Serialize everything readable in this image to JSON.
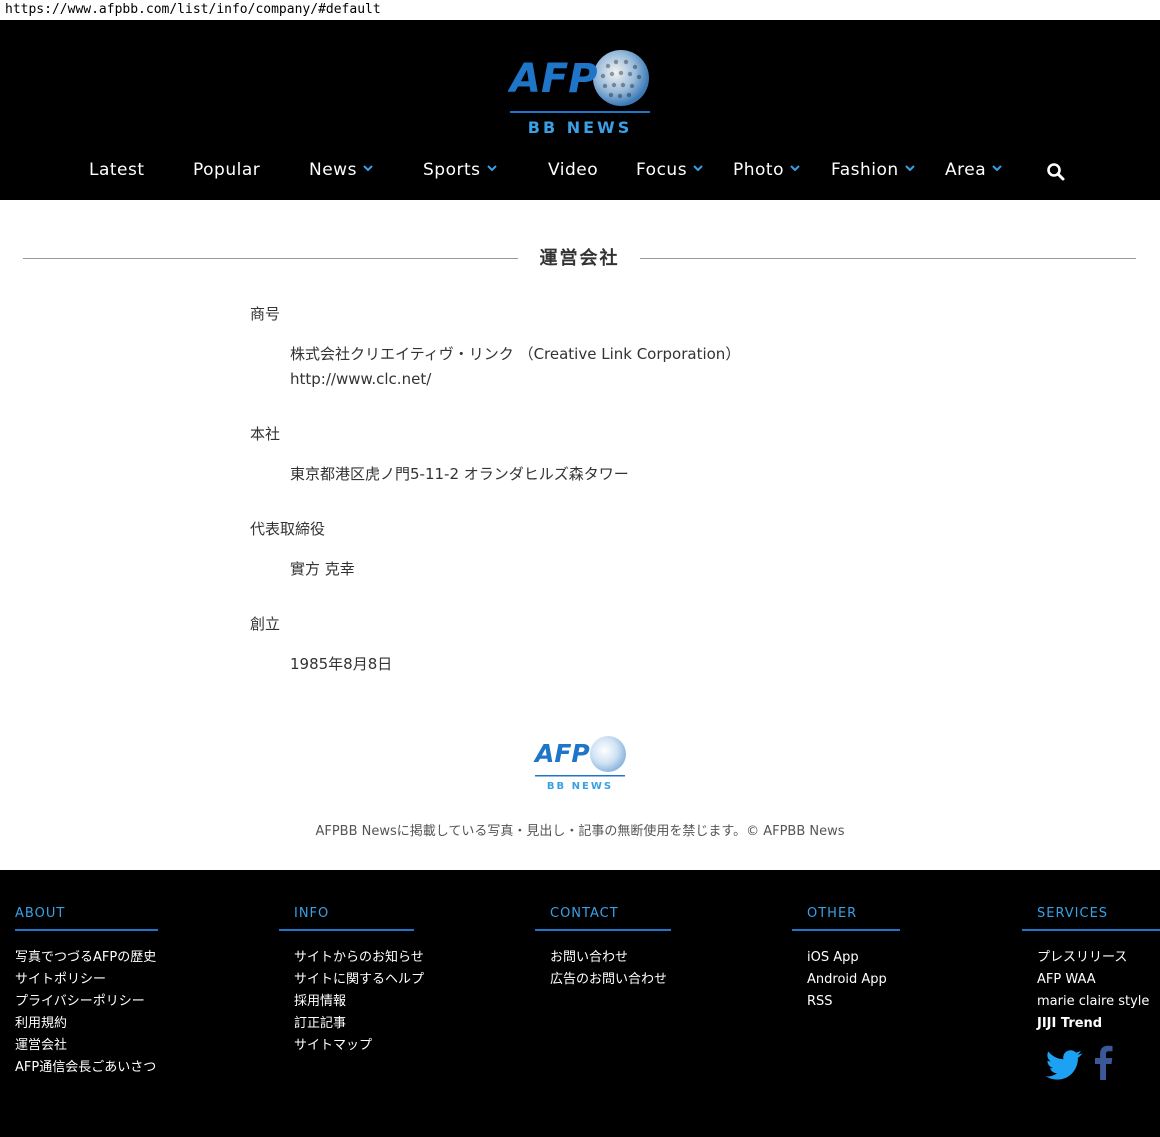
{
  "url": "https://www.afpbb.com/list/info/company/#default",
  "brand": {
    "logo_text": "AFP",
    "logo_sub": "BB NEWS",
    "accent": "#1f75c8",
    "accent_light": "#3aa0e6"
  },
  "nav": {
    "items": [
      {
        "label": "Latest",
        "has_menu": false
      },
      {
        "label": "Popular",
        "has_menu": false
      },
      {
        "label": "News",
        "has_menu": true
      },
      {
        "label": "Sports",
        "has_menu": true
      },
      {
        "label": "Video",
        "has_menu": false
      },
      {
        "label": "Focus",
        "has_menu": true
      },
      {
        "label": "Photo",
        "has_menu": true
      },
      {
        "label": "Fashion",
        "has_menu": true
      },
      {
        "label": "Area",
        "has_menu": true
      }
    ],
    "search_icon": "search-icon"
  },
  "page": {
    "title": "運営会社",
    "sections": [
      {
        "label": "商号",
        "lines": [
          "株式会社クリエイティヴ・リンク （Creative Link Corporation）",
          "http://www.clc.net/"
        ]
      },
      {
        "label": "本社",
        "lines": [
          "東京都港区虎ノ門5-11-2 オランダヒルズ森タワー"
        ]
      },
      {
        "label": "代表取締役",
        "lines": [
          "實方 克幸"
        ]
      },
      {
        "label": "創立",
        "lines": [
          "1985年8月8日"
        ]
      }
    ]
  },
  "copyright": "AFPBB Newsに掲載している写真・見出し・記事の無断使用を禁じます。© AFPBB News",
  "footer": {
    "about": {
      "heading": "ABOUT",
      "links": [
        "写真でつづるAFPの歴史",
        "サイトポリシー",
        "プライバシーポリシー",
        "利用規約",
        "運営会社",
        "AFP通信会長ごあいさつ"
      ]
    },
    "info": {
      "heading": "INFO",
      "links": [
        "サイトからのお知らせ",
        "サイトに関するヘルプ",
        "採用情報",
        "訂正記事",
        "サイトマップ"
      ]
    },
    "contact": {
      "heading": "CONTACT",
      "links": [
        "お問い合わせ",
        "広告のお問い合わせ"
      ]
    },
    "other": {
      "heading": "OTHER",
      "links": [
        "iOS App",
        "Android App",
        "RSS"
      ]
    },
    "services": {
      "heading": "SERVICES",
      "links": [
        "プレスリリース",
        "AFP WAA",
        "marie claire style"
      ],
      "jiji_logo": "JIJI Trend"
    },
    "social": {
      "twitter_color": "#1da1f2",
      "facebook_color": "#3b5998"
    }
  }
}
